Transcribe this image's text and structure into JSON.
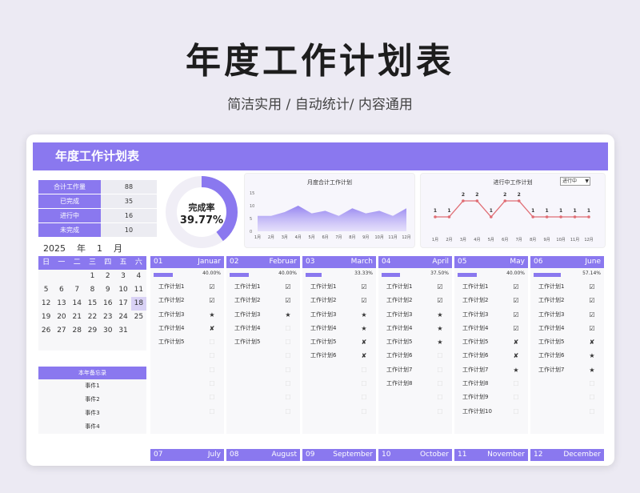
{
  "hero": {
    "title": "年度工作计划表",
    "subtitle": "简洁实用 / 自动统计/ 内容通用"
  },
  "banner": {
    "title": "年度工作计划表"
  },
  "stats": [
    {
      "k": "合计工作量",
      "v": "88"
    },
    {
      "k": "已完成",
      "v": "35"
    },
    {
      "k": "进行中",
      "v": "16"
    },
    {
      "k": "未完成",
      "v": "10"
    }
  ],
  "donut": {
    "label": "完成率",
    "value": "39.77%",
    "fraction": 0.3977,
    "color": "#8a78ef"
  },
  "area_chart": {
    "type": "area",
    "title": "月度合计工作计划",
    "categories": [
      "1月",
      "2月",
      "3月",
      "4月",
      "5月",
      "6月",
      "7月",
      "8月",
      "9月",
      "10月",
      "11月",
      "12月"
    ],
    "values": [
      6,
      6,
      7.5,
      10,
      7,
      8,
      6,
      9,
      7,
      8,
      6,
      9
    ],
    "ylim": [
      0,
      15
    ],
    "yticks": [
      "15",
      "10",
      "5",
      "0"
    ]
  },
  "line_chart": {
    "type": "line",
    "title": "进行中工作计划",
    "select": "进行中",
    "categories": [
      "1月",
      "2月",
      "3月",
      "4月",
      "5月",
      "6月",
      "7月",
      "8月",
      "9月",
      "10月",
      "11月",
      "12月"
    ],
    "values": [
      1,
      1,
      2,
      2,
      1,
      2,
      2,
      1,
      1,
      1,
      1,
      1
    ],
    "labels": [
      "1",
      "1",
      "2",
      "2",
      "1",
      "2",
      "2",
      "1",
      "1",
      "1",
      "1",
      "1"
    ]
  },
  "calendar": {
    "year": "2025",
    "year_unit": "年",
    "month": "1",
    "month_unit": "月",
    "weekdays": [
      "日",
      "一",
      "二",
      "三",
      "四",
      "五",
      "六"
    ],
    "rows": [
      [
        "",
        "",
        "",
        "1",
        "2",
        "3",
        "4"
      ],
      [
        "5",
        "6",
        "7",
        "8",
        "9",
        "10",
        "11"
      ],
      [
        "12",
        "13",
        "14",
        "15",
        "16",
        "17",
        "18"
      ],
      [
        "19",
        "20",
        "21",
        "22",
        "23",
        "24",
        "25"
      ],
      [
        "26",
        "27",
        "28",
        "29",
        "30",
        "31",
        ""
      ]
    ],
    "today": "18"
  },
  "memo": {
    "title": "本年备忘录",
    "items": [
      "事件1",
      "事件2",
      "事件3",
      "事件4"
    ]
  },
  "months": [
    {
      "num": "01",
      "name": "Januar",
      "pct": "40.00%",
      "fill": 0.4,
      "tasks": [
        [
          "工作计划1",
          "☑"
        ],
        [
          "工作计划2",
          "☑"
        ],
        [
          "工作计划3",
          "★"
        ],
        [
          "工作计划4",
          "✘"
        ],
        [
          "工作计划5",
          "☐"
        ],
        [
          "",
          "☐"
        ],
        [
          "",
          "☐"
        ],
        [
          "",
          "☐"
        ],
        [
          "",
          "☐"
        ],
        [
          "",
          "☐"
        ]
      ]
    },
    {
      "num": "02",
      "name": "Februar",
      "pct": "40.00%",
      "fill": 0.4,
      "tasks": [
        [
          "工作计划1",
          "☑"
        ],
        [
          "工作计划2",
          "☑"
        ],
        [
          "工作计划3",
          "★"
        ],
        [
          "工作计划4",
          "☐"
        ],
        [
          "工作计划5",
          "☐"
        ],
        [
          "",
          "☐"
        ],
        [
          "",
          "☐"
        ],
        [
          "",
          "☐"
        ],
        [
          "",
          "☐"
        ],
        [
          "",
          "☐"
        ]
      ]
    },
    {
      "num": "03",
      "name": "March",
      "pct": "33.33%",
      "fill": 0.3333,
      "tasks": [
        [
          "工作计划1",
          "☑"
        ],
        [
          "工作计划2",
          "☑"
        ],
        [
          "工作计划3",
          "★"
        ],
        [
          "工作计划4",
          "★"
        ],
        [
          "工作计划5",
          "✘"
        ],
        [
          "工作计划6",
          "✘"
        ],
        [
          "",
          "☐"
        ],
        [
          "",
          "☐"
        ],
        [
          "",
          "☐"
        ],
        [
          "",
          "☐"
        ]
      ]
    },
    {
      "num": "04",
      "name": "April",
      "pct": "37.50%",
      "fill": 0.375,
      "tasks": [
        [
          "工作计划1",
          "☑"
        ],
        [
          "工作计划2",
          "☑"
        ],
        [
          "工作计划3",
          "★"
        ],
        [
          "工作计划4",
          "★"
        ],
        [
          "工作计划5",
          "★"
        ],
        [
          "工作计划6",
          "☐"
        ],
        [
          "工作计划7",
          "☐"
        ],
        [
          "工作计划8",
          "☐"
        ],
        [
          "",
          "☐"
        ],
        [
          "",
          "☐"
        ]
      ]
    },
    {
      "num": "05",
      "name": "May",
      "pct": "40.00%",
      "fill": 0.4,
      "tasks": [
        [
          "工作计划1",
          "☑"
        ],
        [
          "工作计划2",
          "☑"
        ],
        [
          "工作计划3",
          "☑"
        ],
        [
          "工作计划4",
          "☑"
        ],
        [
          "工作计划5",
          "✘"
        ],
        [
          "工作计划6",
          "✘"
        ],
        [
          "工作计划7",
          "★"
        ],
        [
          "工作计划8",
          "☐"
        ],
        [
          "工作计划9",
          "☐"
        ],
        [
          "工作计划10",
          "☐"
        ]
      ]
    },
    {
      "num": "06",
      "name": "June",
      "pct": "57.14%",
      "fill": 0.5714,
      "tasks": [
        [
          "工作计划1",
          "☑"
        ],
        [
          "工作计划2",
          "☑"
        ],
        [
          "工作计划3",
          "☑"
        ],
        [
          "工作计划4",
          "☑"
        ],
        [
          "工作计划5",
          "✘"
        ],
        [
          "工作计划6",
          "★"
        ],
        [
          "工作计划7",
          "★"
        ],
        [
          "",
          "☐"
        ],
        [
          "",
          "☐"
        ],
        [
          "",
          "☐"
        ]
      ]
    }
  ],
  "bottom_months": [
    {
      "num": "07",
      "name": "July"
    },
    {
      "num": "08",
      "name": "August"
    },
    {
      "num": "09",
      "name": "September"
    },
    {
      "num": "10",
      "name": "October"
    },
    {
      "num": "11",
      "name": "November"
    },
    {
      "num": "12",
      "name": "December"
    }
  ]
}
